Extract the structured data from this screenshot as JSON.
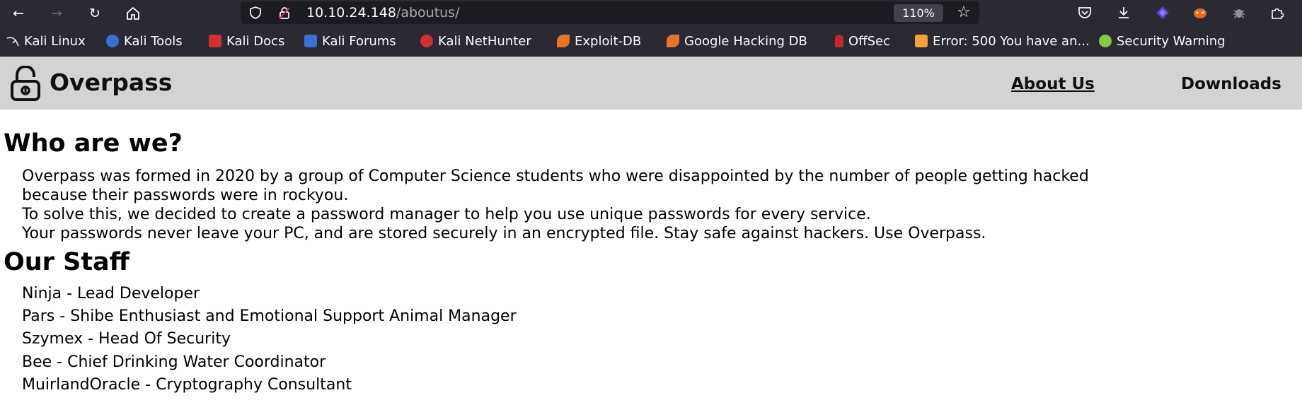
{
  "browser": {
    "url_host": "10.10.24.148",
    "url_path": "/aboutus/",
    "zoom": "110%",
    "bookmarks": [
      {
        "label": "Kali Linux",
        "icon": "kali-dragon-icon",
        "color": "#e6e6e6"
      },
      {
        "label": "Kali Tools",
        "icon": "kali-tools-icon",
        "color": "#e0454f"
      },
      {
        "label": "Kali Docs",
        "icon": "kali-docs-icon",
        "color": "#d32f2f"
      },
      {
        "label": "Kali Forums",
        "icon": "kali-forums-icon",
        "color": "#3b6fd1"
      },
      {
        "label": "Kali NetHunter",
        "icon": "kali-nethunter-icon",
        "color": "#d32f2f"
      },
      {
        "label": "Exploit-DB",
        "icon": "exploit-db-icon",
        "color": "#e8742c"
      },
      {
        "label": "Google Hacking DB",
        "icon": "ghdb-icon",
        "color": "#e8742c"
      },
      {
        "label": "OffSec",
        "icon": "offsec-icon",
        "color": "#c62828"
      },
      {
        "label": "Error: 500 You have an...",
        "icon": "joomla-icon",
        "color": "#f0a33a"
      },
      {
        "label": "Security Warning",
        "icon": "security-warning-icon",
        "color": "#8bc34a"
      }
    ]
  },
  "site": {
    "title": "Overpass",
    "nav": [
      {
        "label": "About Us"
      },
      {
        "label": "Downloads"
      }
    ]
  },
  "content": {
    "heading_who": "Who are we?",
    "paragraph_lines": [
      "Overpass was formed in 2020 by a group of Computer Science students who were disappointed by the number of people getting hacked",
      "because their passwords were in rockyou.",
      "To solve this, we decided to create a password manager to help you use unique passwords for every service.",
      "Your passwords never leave your PC, and are stored securely in an encrypted file. Stay safe against hackers. Use Overpass."
    ],
    "heading_staff": "Our Staff",
    "staff": [
      "Ninja - Lead Developer",
      "Pars - Shibe Enthusiast and Emotional Support Animal Manager",
      "Szymex - Head Of Security",
      "Bee - Chief Drinking Water Coordinator",
      "MuirlandOracle - Cryptography Consultant"
    ]
  }
}
